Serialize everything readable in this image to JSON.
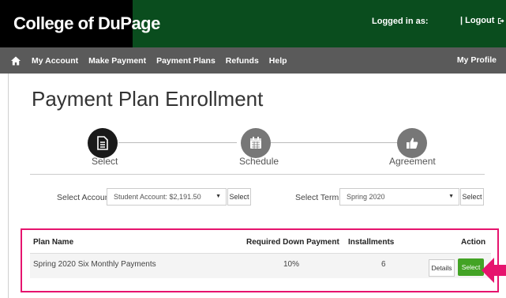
{
  "header": {
    "brand_name": "College of DuPage",
    "logged_in_label": "Logged in as:",
    "logout_label": "| Logout"
  },
  "nav": {
    "items": [
      "My Account",
      "Make Payment",
      "Payment Plans",
      "Refunds",
      "Help"
    ],
    "profile_label": "My Profile"
  },
  "page": {
    "title": "Payment Plan Enrollment"
  },
  "steps": [
    {
      "label": "Select",
      "icon": "document-icon",
      "state": "active"
    },
    {
      "label": "Schedule",
      "icon": "calendar-icon",
      "state": "inactive"
    },
    {
      "label": "Agreement",
      "icon": "thumbs-up-icon",
      "state": "inactive"
    }
  ],
  "account_select": {
    "label": "Select Account",
    "value": "Student Account: $2,191.50",
    "button_label": "Select"
  },
  "term_select": {
    "label": "Select Term",
    "value": "Spring 2020",
    "button_label": "Select"
  },
  "plans_table": {
    "headers": [
      "Plan Name",
      "Required Down Payment",
      "Installments",
      "Action"
    ],
    "rows": [
      {
        "plan_name": "Spring 2020 Six Monthly Payments",
        "down_payment": "10%",
        "installments": "6",
        "details_label": "Details",
        "select_label": "Select"
      }
    ]
  },
  "colors": {
    "header_green": "#0a4d1e",
    "nav_gray": "#5a5a5a",
    "highlight_pink": "#e6146e",
    "button_green": "#43a325"
  }
}
